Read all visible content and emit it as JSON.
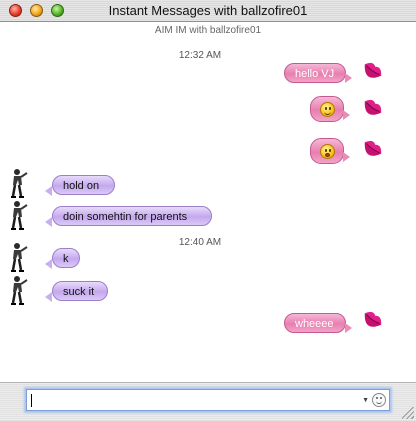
{
  "window": {
    "title": "Instant Messages with ballzofire01",
    "subtitle": "AIM IM with ballzofire01"
  },
  "transcript": {
    "timestamps": [
      "12:32 AM",
      "12:40 AM"
    ],
    "messages": [
      {
        "sender": "me",
        "kind": "text",
        "text": "hello VJ"
      },
      {
        "sender": "me",
        "kind": "emoticon",
        "icon": "smile-emoticon-icon"
      },
      {
        "sender": "me",
        "kind": "emoticon",
        "icon": "kiss-emoticon-icon"
      },
      {
        "sender": "buddy",
        "kind": "text",
        "text": "hold on"
      },
      {
        "sender": "buddy",
        "kind": "text",
        "text": "doin somehtin for parents"
      },
      {
        "sender": "buddy",
        "kind": "text",
        "text": "k"
      },
      {
        "sender": "buddy",
        "kind": "text",
        "text": "suck it"
      },
      {
        "sender": "me",
        "kind": "text",
        "text": "wheeee"
      }
    ]
  },
  "compose": {
    "value": ""
  },
  "colors": {
    "my_bubble": "#e77fb0",
    "buddy_bubble": "#c5a8ee",
    "focus_ring": "#a8c4ef"
  }
}
